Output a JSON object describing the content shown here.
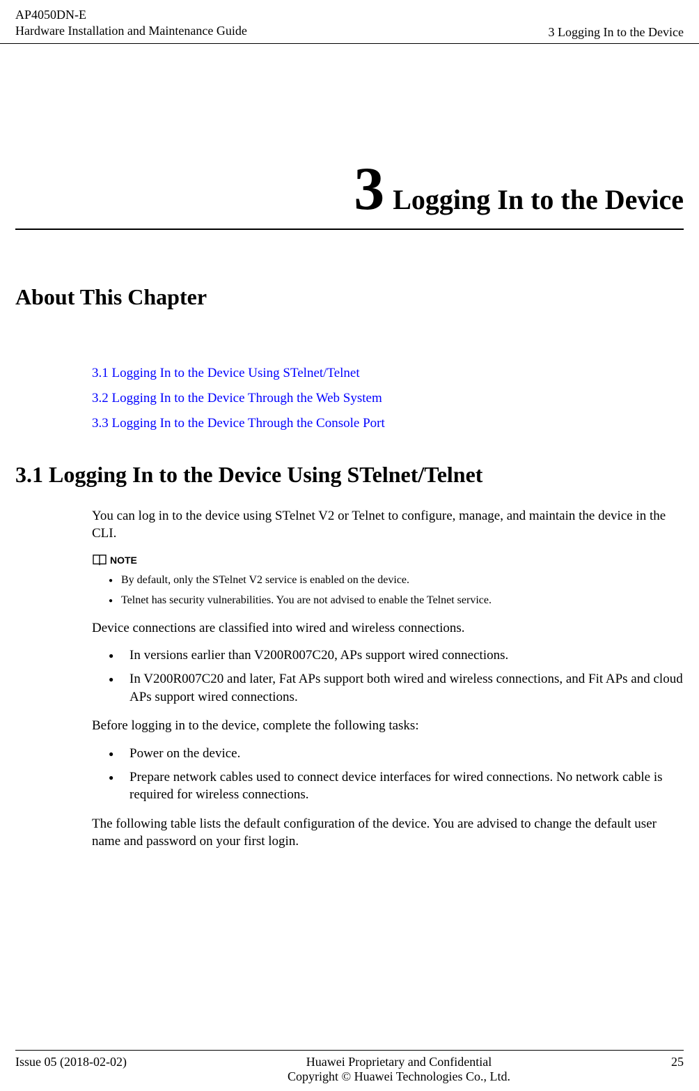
{
  "header": {
    "product": "AP4050DN-E",
    "guide": "Hardware Installation and Maintenance Guide",
    "chapter_ref": "3 Logging In to the Device"
  },
  "chapter": {
    "number": "3",
    "title": "Logging In to the Device"
  },
  "about_heading": "About This Chapter",
  "toc": [
    "3.1 Logging In to the Device Using STelnet/Telnet",
    "3.2 Logging In to the Device Through the Web System",
    "3.3 Logging In to the Device Through the Console Port"
  ],
  "section_heading": "3.1 Logging In to the Device Using STelnet/Telnet",
  "intro_para": "You can log in to the device using STelnet V2 or Telnet to configure, manage, and maintain the device in the CLI.",
  "note_label": "NOTE",
  "note_items": [
    "By default, only the STelnet V2 service is enabled on the device.",
    "Telnet has security vulnerabilities. You are not advised to enable the Telnet service."
  ],
  "device_conn_para": "Device connections are classified into wired and wireless connections.",
  "version_items": [
    "In versions earlier than V200R007C20, APs support wired connections.",
    "In V200R007C20 and later, Fat APs support both wired and wireless connections, and Fit APs and cloud APs support wired connections."
  ],
  "before_para": "Before logging in to the device, complete the following tasks:",
  "task_items": [
    "Power on the device.",
    "Prepare network cables used to connect device interfaces for wired connections. No network cable is required for wireless connections."
  ],
  "table_intro_para": "The following table lists the default configuration of the device. You are advised to change the default user name and password on your first login.",
  "footer": {
    "issue": "Issue 05 (2018-02-02)",
    "confidential": "Huawei Proprietary and Confidential",
    "copyright": "Copyright © Huawei Technologies Co., Ltd.",
    "page": "25"
  }
}
